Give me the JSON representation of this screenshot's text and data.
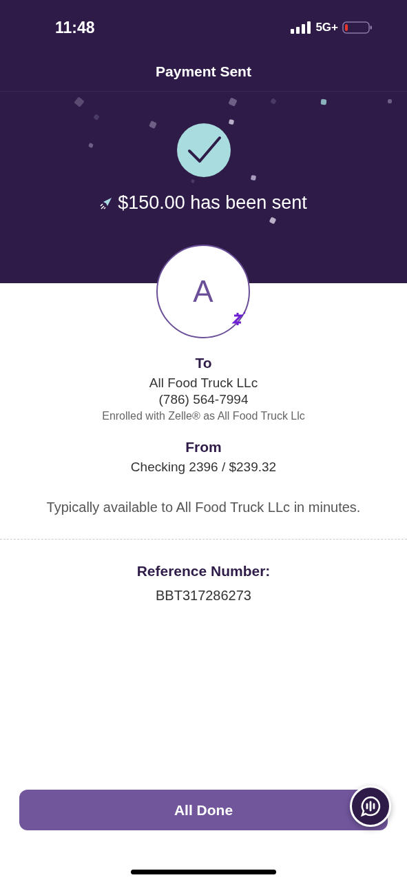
{
  "status_bar": {
    "time": "11:48",
    "network": "5G+"
  },
  "header": {
    "title": "Payment Sent"
  },
  "confirmation": {
    "amount_message": "$150.00 has been sent"
  },
  "recipient": {
    "avatar_initial": "A",
    "label": "To",
    "name": "All Food Truck LLc",
    "phone": "(786) 564-7994",
    "enrolled_note": "Enrolled with Zelle® as All Food Truck Llc"
  },
  "source": {
    "label": "From",
    "account": "Checking 2396 / $239.32"
  },
  "availability_note": "Typically available to All Food Truck LLc in minutes.",
  "reference": {
    "label": "Reference Number:",
    "number": "BBT317286273"
  },
  "done_button": {
    "label": "All Done"
  }
}
